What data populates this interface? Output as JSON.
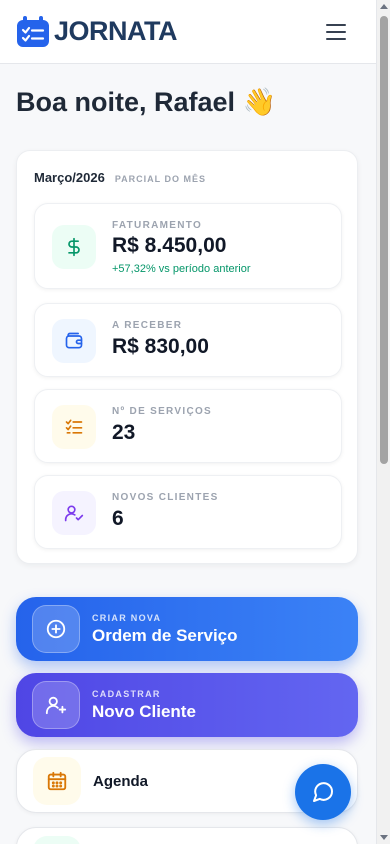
{
  "app": {
    "name": "JORNATA"
  },
  "greeting": {
    "text": "Boa noite, Rafael",
    "emoji": "👋"
  },
  "summary": {
    "month": "Março/2026",
    "period": "Parcial do mês",
    "stats": [
      {
        "label": "Faturamento",
        "value": "R$ 8.450,00",
        "change": "+57,32% vs período anterior",
        "icon": "dollar-icon",
        "color": "#059669",
        "bg": "#ecfdf5"
      },
      {
        "label": "A receber",
        "value": "R$ 830,00",
        "icon": "wallet-icon",
        "color": "#2563eb",
        "bg": "#eff6ff"
      },
      {
        "label": "Nº de serviços",
        "value": "23",
        "icon": "checklist-icon",
        "color": "#d97706",
        "bg": "#fffbeb"
      },
      {
        "label": "Novos clientes",
        "value": "6",
        "icon": "user-check-icon",
        "color": "#7c3aed",
        "bg": "#f5f3ff"
      }
    ]
  },
  "actions": [
    {
      "label": "Criar nova",
      "title": "Ordem de Serviço",
      "icon": "plus-circle-icon"
    },
    {
      "label": "Cadastrar",
      "title": "Novo Cliente",
      "icon": "user-plus-icon"
    },
    {
      "title": "Agenda",
      "icon": "calendar-icon"
    }
  ],
  "colors": {
    "brand": "#1f3a5f",
    "primary": "#2563eb",
    "secondary": "#4f46e5",
    "fab": "#1a73e8"
  }
}
